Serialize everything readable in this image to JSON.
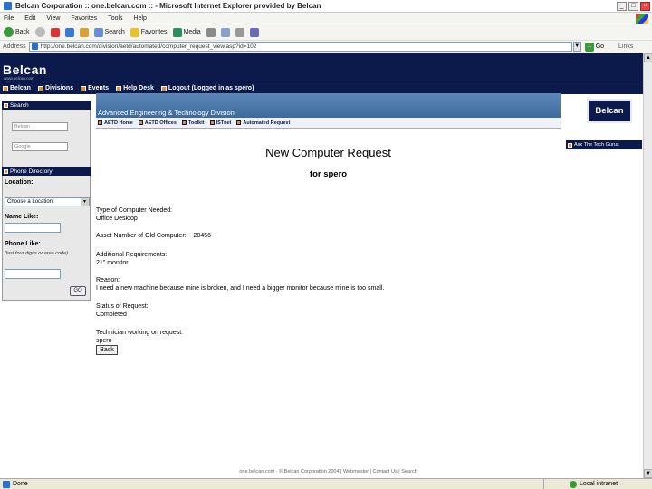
{
  "window": {
    "title": "Belcan Corporation :: one.belcan.com :: - Microsoft Internet Explorer provided by Belcan",
    "controls": [
      "_",
      "□",
      "×"
    ]
  },
  "menu": [
    "File",
    "Edit",
    "View",
    "Favorites",
    "Tools",
    "Help"
  ],
  "toolbar": {
    "back": "Back",
    "forward": "",
    "search": "Search",
    "favorites": "Favorites",
    "media": "Media"
  },
  "address": {
    "label": "Address",
    "url": "http://one.belcan.com/division/aetd/automated/computer_request_view.asp?id=102",
    "go": "Go",
    "links": "Links"
  },
  "site": {
    "logo": "Belcan",
    "logo_sub": "www.belcan.com",
    "nav": [
      "Belcan",
      "Divisions",
      "Events",
      "Help Desk",
      "Logout (Logged in as spero)"
    ]
  },
  "search_box": {
    "title": "Search",
    "fields": [
      "Belcan",
      "Google"
    ]
  },
  "phone_directory": {
    "title": "Phone Directory",
    "location_label": "Location:",
    "location_value": "Choose a Location",
    "name_label": "Name Like:",
    "phone_label": "Phone Like:",
    "phone_hint": "(last four digits or area code)",
    "go": "GO"
  },
  "division": {
    "title": "Advanced Engineering & Technology Division",
    "tabs": [
      "AETD Home",
      "AETD Offices",
      "Toolkit",
      "ISTnet",
      "Automated Request"
    ]
  },
  "badge": "Belcan",
  "ask": "Ask The Tech Gurus",
  "request": {
    "title": "New Computer Request",
    "subtitle": "for spero",
    "type_label": "Type of Computer Needed:",
    "type_value": "Office Desktop",
    "asset_label": "Asset Number of Old Computer:",
    "asset_value": "20456",
    "req_label": "Additional Requirements:",
    "req_value": "21\" monitor",
    "reason_label": "Reason:",
    "reason_value": "I need a new machine because mine is broken, and I need a bigger monitor because mine is too small.",
    "status_label": "Status of Request:",
    "status_value": "Completed",
    "tech_label": "Technician working on request:",
    "tech_value": "spero",
    "back": "Back"
  },
  "footer": "one.belcan.com · © Belcan Corporation 2004 | Webmaster | Contact Us | Search",
  "status": {
    "left": "Done",
    "zone": "Local intranet"
  }
}
